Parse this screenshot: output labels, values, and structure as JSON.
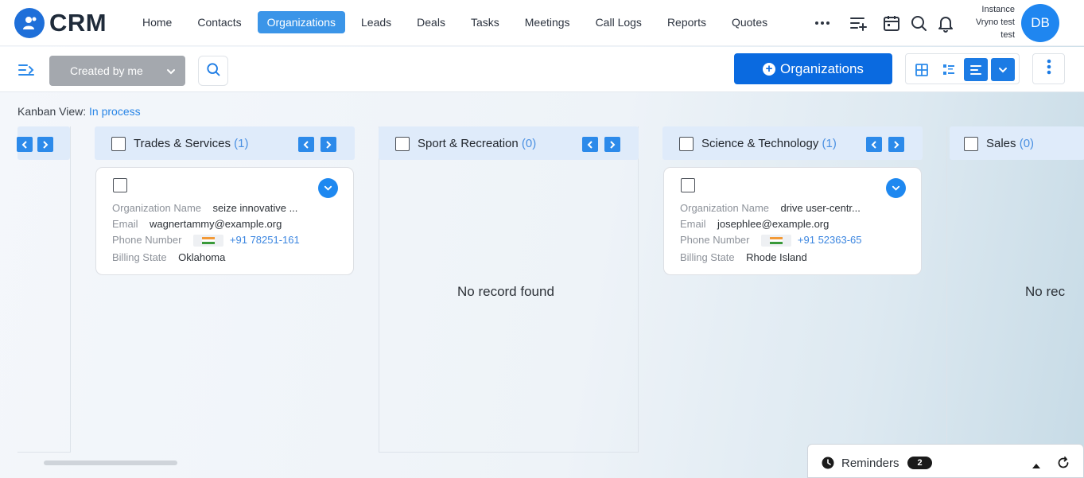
{
  "app": {
    "logo_text": "CRM"
  },
  "nav": {
    "items": [
      "Home",
      "Contacts",
      "Organizations",
      "Leads",
      "Deals",
      "Tasks",
      "Meetings",
      "Call Logs",
      "Reports",
      "Quotes"
    ],
    "active": "Organizations"
  },
  "user": {
    "instance_label": "Instance",
    "name_line1": "Vryno test",
    "name_line2": "test",
    "initials": "DB"
  },
  "toolbar": {
    "filter_value": "Created by me",
    "add_button_label": "Organizations"
  },
  "kanban": {
    "view_label": "Kanban View:",
    "view_value": "In process",
    "empty_text": "No record found",
    "empty_text_partial": "No rec"
  },
  "columns": [
    {
      "title": "Trades & Services",
      "count": "(1)"
    },
    {
      "title": "Sport & Recreation",
      "count": "(0)"
    },
    {
      "title": "Science & Technology",
      "count": "(1)"
    },
    {
      "title": "Sales",
      "count": "(0)"
    }
  ],
  "field_labels": {
    "org_name": "Organization Name",
    "email": "Email",
    "phone": "Phone Number",
    "billing_state": "Billing State"
  },
  "cards": [
    {
      "org_name": "seize innovative ...",
      "email": "wagnertammy@example.org",
      "phone": "+91 78251-161",
      "billing_state": "Oklahoma"
    },
    {
      "org_name": "drive user-centr...",
      "email": "josephlee@example.org",
      "phone": "+91 52363-65",
      "billing_state": "Rhode Island"
    }
  ],
  "reminders": {
    "label": "Reminders",
    "count": "2"
  },
  "colors": {
    "primary": "#0a6ae0",
    "nav_active": "#3b95e8",
    "avatar": "#1f86f0",
    "column_header": "#dfebfa"
  },
  "icons": [
    "user-icon",
    "more-horizontal-icon",
    "add-list-icon",
    "calendar-icon",
    "search-icon",
    "bell-icon",
    "sidebar-toggle-icon",
    "chevron-down-icon",
    "plus-circle-icon",
    "grid-view-icon",
    "list-view-icon",
    "kanban-view-icon",
    "more-vertical-icon",
    "chevron-left-icon",
    "chevron-right-icon",
    "india-flag-icon",
    "clock-icon",
    "caret-up-icon",
    "refresh-icon"
  ]
}
